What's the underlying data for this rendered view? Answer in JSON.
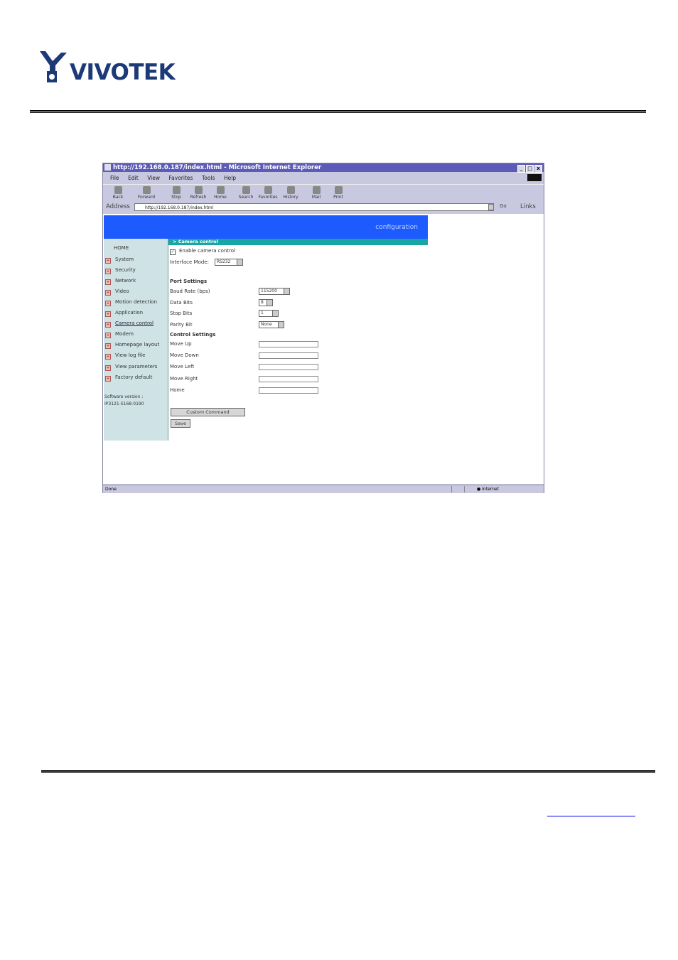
{
  "header": {
    "logo_text": "VIVOTEK"
  },
  "browser": {
    "title": "http://192.168.0.187/index.html - Microsoft Internet Explorer",
    "window_controls": [
      "_",
      "□",
      "x"
    ],
    "menu": [
      "File",
      "Edit",
      "View",
      "Favorites",
      "Tools",
      "Help"
    ],
    "toolbar": [
      "Back",
      "Forward",
      "Stop",
      "Refresh",
      "Home",
      "Search",
      "Favorites",
      "History",
      "Mail",
      "Print"
    ],
    "address_label": "Address",
    "address_value": "http://192.168.0.187/index.html",
    "go_label": "Go",
    "links_label": "Links",
    "status_text": "Done",
    "zone_text": "Internet"
  },
  "page": {
    "banner": "configuration",
    "section_title": "> Camera control",
    "sidebar": {
      "home": "HOME",
      "items": [
        "System",
        "Security",
        "Network",
        "Video",
        "Motion detection",
        "Application",
        "Camera control",
        "Modem",
        "Homepage layout",
        "View log file",
        "View parameters",
        "Factory default"
      ],
      "version_label": "Software version :",
      "version_value": "IP3121-S168-0190"
    },
    "form": {
      "enable_label": "Enable camera control",
      "interface_label": "Interface Mode:",
      "interface_value": "RS232",
      "port_heading": "Port Settings",
      "baud_label": "Baud Rate (bps)",
      "baud_value": "115200",
      "data_bits_label": "Data Bits",
      "data_bits_value": "8",
      "stop_bits_label": "Stop Bits",
      "stop_bits_value": "1",
      "parity_label": "Parity Bit",
      "parity_value": "None",
      "control_heading": "Control Settings",
      "move_up": "Move Up",
      "move_down": "Move Down",
      "move_left": "Move Left",
      "move_right": "Move Right",
      "home": "Home",
      "custom_button": "Custom Command",
      "save_button": "Save"
    }
  }
}
